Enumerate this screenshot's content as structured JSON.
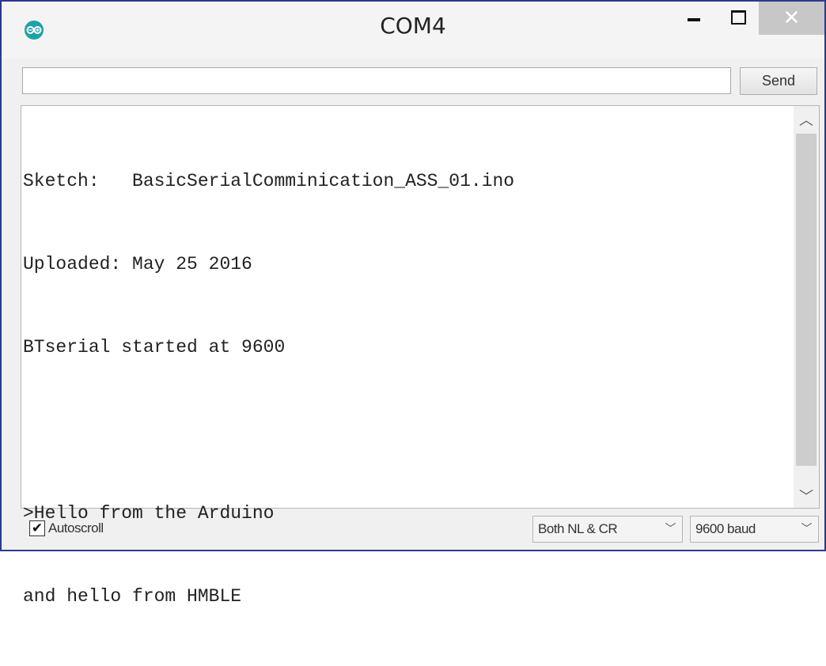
{
  "window": {
    "title": "COM4",
    "minimize_glyph": "–",
    "close_glyph": "✕"
  },
  "send_row": {
    "input_value": "",
    "send_label": "Send"
  },
  "output": {
    "lines": [
      "Sketch:   BasicSerialComminication_ASS_01.ino",
      "Uploaded: May 25 2016",
      "BTserial started at 9600",
      "",
      ">Hello from the Arduino",
      "and hello from HMBLE"
    ]
  },
  "statusbar": {
    "autoscroll_label": "Autoscroll",
    "autoscroll_checked": true,
    "line_ending": "Both NL & CR",
    "baud_rate": "9600 baud"
  },
  "colors": {
    "window_border": "#2b3a8f",
    "app_icon": "#1fa1a8",
    "close_button": "#c7c7c7"
  },
  "icons": {
    "app": "arduino-logo-icon",
    "scroll_up": "chevron-up-icon",
    "scroll_down": "chevron-down-icon",
    "check": "checkmark-icon"
  }
}
